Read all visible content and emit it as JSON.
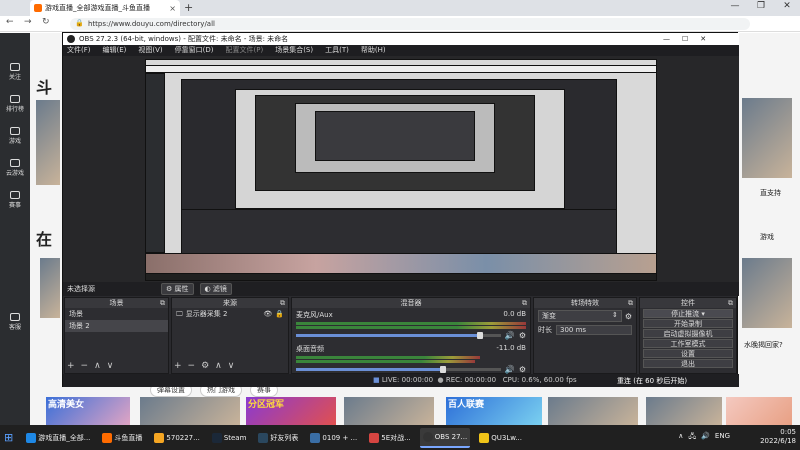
{
  "browser": {
    "tab_title": "游戏直播_全部游戏直播_斗鱼直播",
    "url": "https://www.douyu.com/directory/all",
    "new_tab_symbol": "+",
    "tab_close_symbol": "×",
    "window_controls": [
      "—",
      "❐",
      "✕"
    ]
  },
  "site": {
    "left_nav": [
      {
        "label": "关注",
        "icon": "heart-icon"
      },
      {
        "label": "排行榜",
        "icon": "rank-icon"
      },
      {
        "label": "游戏",
        "icon": "game-icon"
      },
      {
        "label": "云游戏",
        "icon": "cloud-game-icon"
      },
      {
        "label": "赛事",
        "icon": "trophy-icon"
      },
      {
        "label": "客服",
        "icon": "headset-icon"
      }
    ],
    "heading_partial_1": "斗",
    "heading_partial_2": "在",
    "right_caption_1": "直支持",
    "right_caption_2": "游戏",
    "right_caption_3": "水晚揭回家?",
    "bottom_buttons": [
      "弹幕设置",
      "热门游戏",
      "赛事"
    ],
    "banner_labels": [
      "高清美女",
      "分区冠军",
      "百人联赛"
    ]
  },
  "obs": {
    "title": "OBS 27.2.3 (64-bit, windows) - 配置文件: 未命名 - 场景: 未命名",
    "window_controls": [
      "—",
      "☐",
      "✕"
    ],
    "menu": [
      "文件(F)",
      "编辑(E)",
      "视图(V)",
      "停靠窗口(D)",
      "配置文件(P)",
      "场景集合(S)",
      "工具(T)",
      "帮助(H)"
    ],
    "scenes_bar": {
      "label": "未选择源",
      "properties": "属性",
      "filters": "滤镜"
    },
    "scenes": {
      "header": "场景",
      "items": [
        "场景",
        "场景 2"
      ]
    },
    "sources": {
      "header": "来源",
      "items": [
        "显示器采集 2"
      ]
    },
    "mixer": {
      "header": "混音器",
      "channels": [
        {
          "name": "麦克风/Aux",
          "db": "0.0 dB",
          "level": 0.9
        },
        {
          "name": "桌面音频",
          "db": "-11.0 dB",
          "level": 0.72
        }
      ]
    },
    "transitions": {
      "header": "转场特效",
      "type": "渐变",
      "duration_label": "时长",
      "duration_value": "300 ms"
    },
    "controls": {
      "header": "控件",
      "buttons": [
        "停止推流",
        "开始录制",
        "启动虚拟摄像机",
        "工作室模式",
        "设置",
        "退出"
      ]
    },
    "status": {
      "live": "LIVE: 00:00:00",
      "rec": "REC: 00:00:00",
      "cpu": "CPU: 0.6%, 60.00 fps",
      "reconnect": "重连 (在 60 秒后开始)"
    }
  },
  "taskbar": {
    "items": [
      {
        "label": "游戏直播_全部...",
        "color": "#1e88e5"
      },
      {
        "label": "斗鱼直播",
        "color": "#ff6b00"
      },
      {
        "label": "570227...",
        "color": "#f5a623"
      },
      {
        "label": "Steam",
        "color": "#1b2838"
      },
      {
        "label": "好友列表",
        "color": "#2a475e"
      },
      {
        "label": "0109 + ...",
        "color": "#3a6ea5"
      },
      {
        "label": "5E对战...",
        "color": "#d64541"
      },
      {
        "label": "OBS 27...",
        "color": "#333333"
      },
      {
        "label": "QU3Lw...",
        "color": "#f0c419"
      }
    ],
    "language": "ENG",
    "time": "0:05",
    "date": "2022/6/18"
  }
}
